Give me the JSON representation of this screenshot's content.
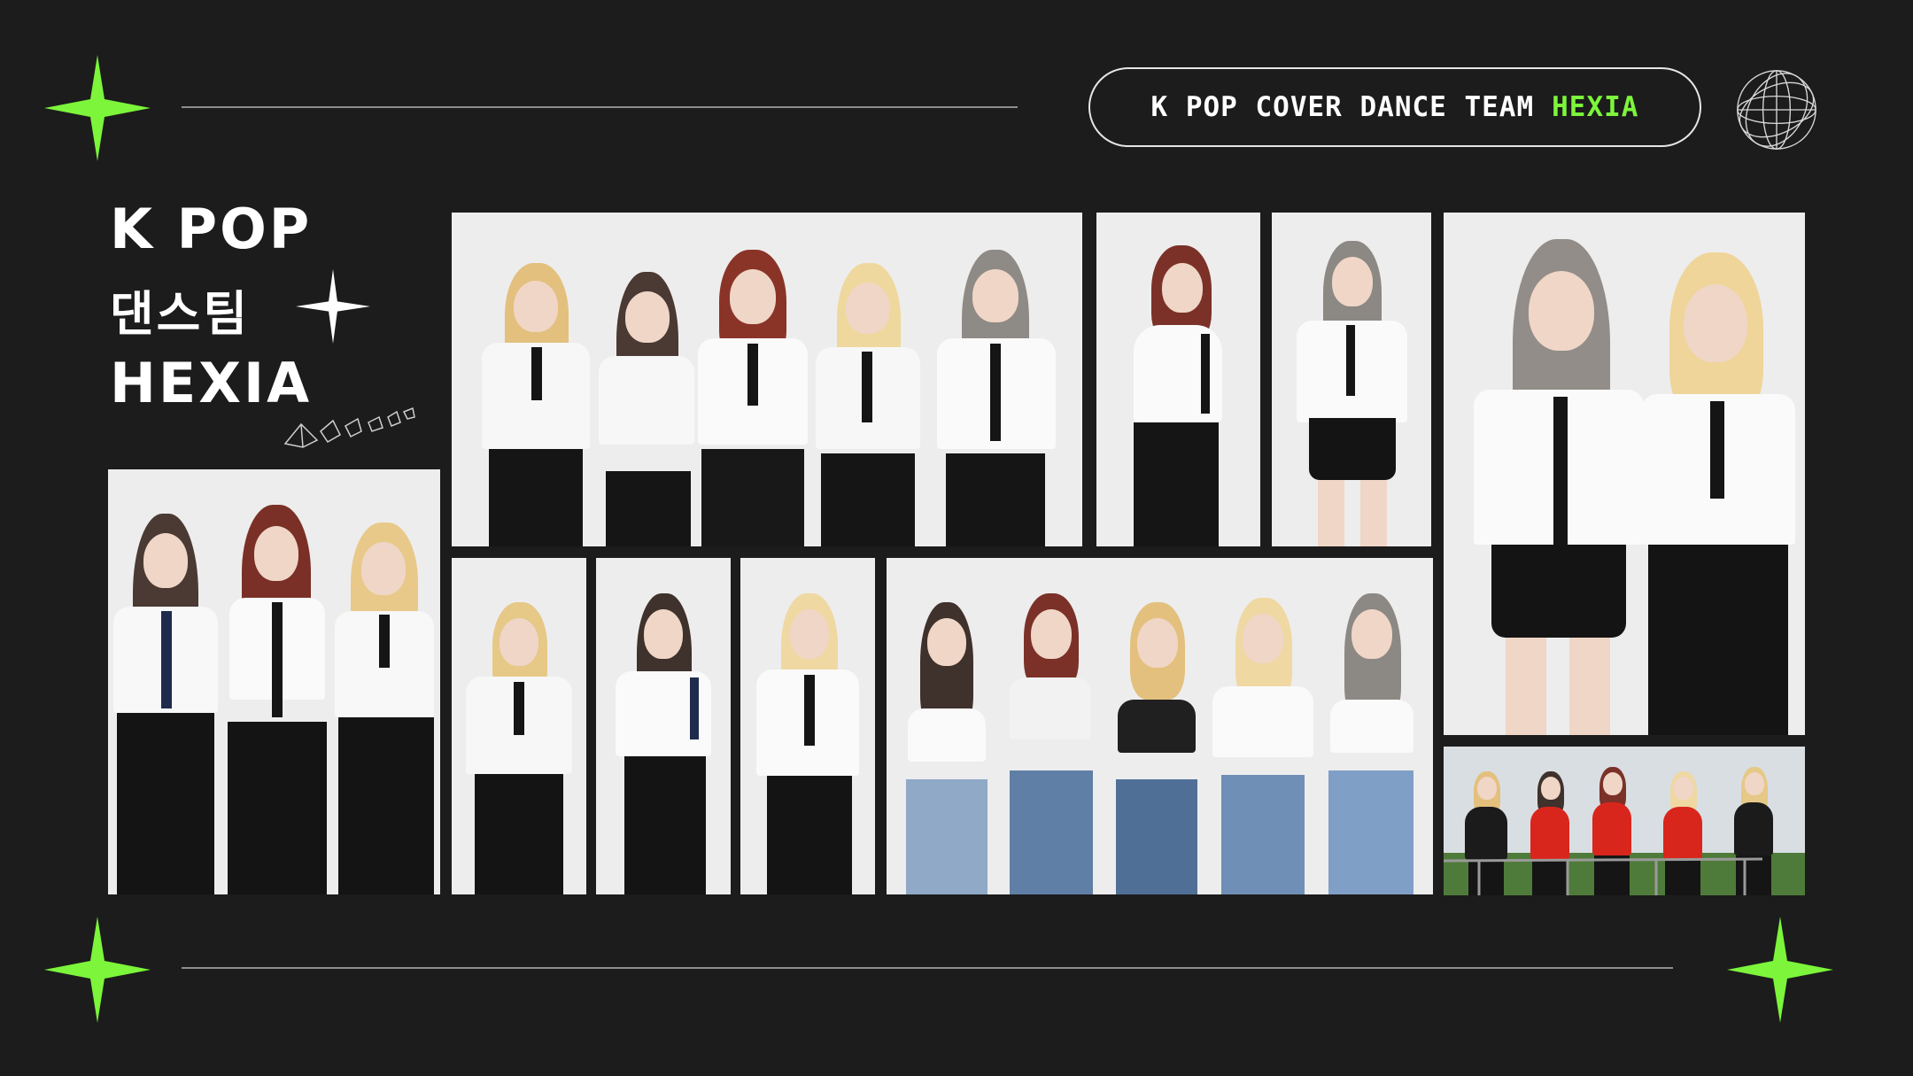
{
  "header": {
    "pill_text": "K POP COVER DANCE TEAM",
    "pill_accent": "HEXIA"
  },
  "title": {
    "line1": "K POP",
    "line2": "댄스팀",
    "line3": "HEXIA"
  },
  "colors": {
    "background": "#1c1c1c",
    "accent": "#7cf53a",
    "text": "#ffffff"
  },
  "icons": [
    "sparkle-star-icon",
    "wireframe-globe-icon",
    "white-sparkle-icon",
    "crystal-shapes-icon"
  ],
  "photos": [
    {
      "id": "group-of-three",
      "subjects": 3
    },
    {
      "id": "group-of-five-uniform",
      "subjects": 5
    },
    {
      "id": "solo-red-hair",
      "subjects": 1
    },
    {
      "id": "solo-grey-hair-skirt",
      "subjects": 1
    },
    {
      "id": "duo-portrait",
      "subjects": 2
    },
    {
      "id": "solo-blonde-crossed-arms",
      "subjects": 1
    },
    {
      "id": "solo-brunette",
      "subjects": 1
    },
    {
      "id": "solo-blonde-white-shirt",
      "subjects": 1
    },
    {
      "id": "group-of-five-denim",
      "subjects": 5
    },
    {
      "id": "stage-performance",
      "subjects": 5
    }
  ]
}
